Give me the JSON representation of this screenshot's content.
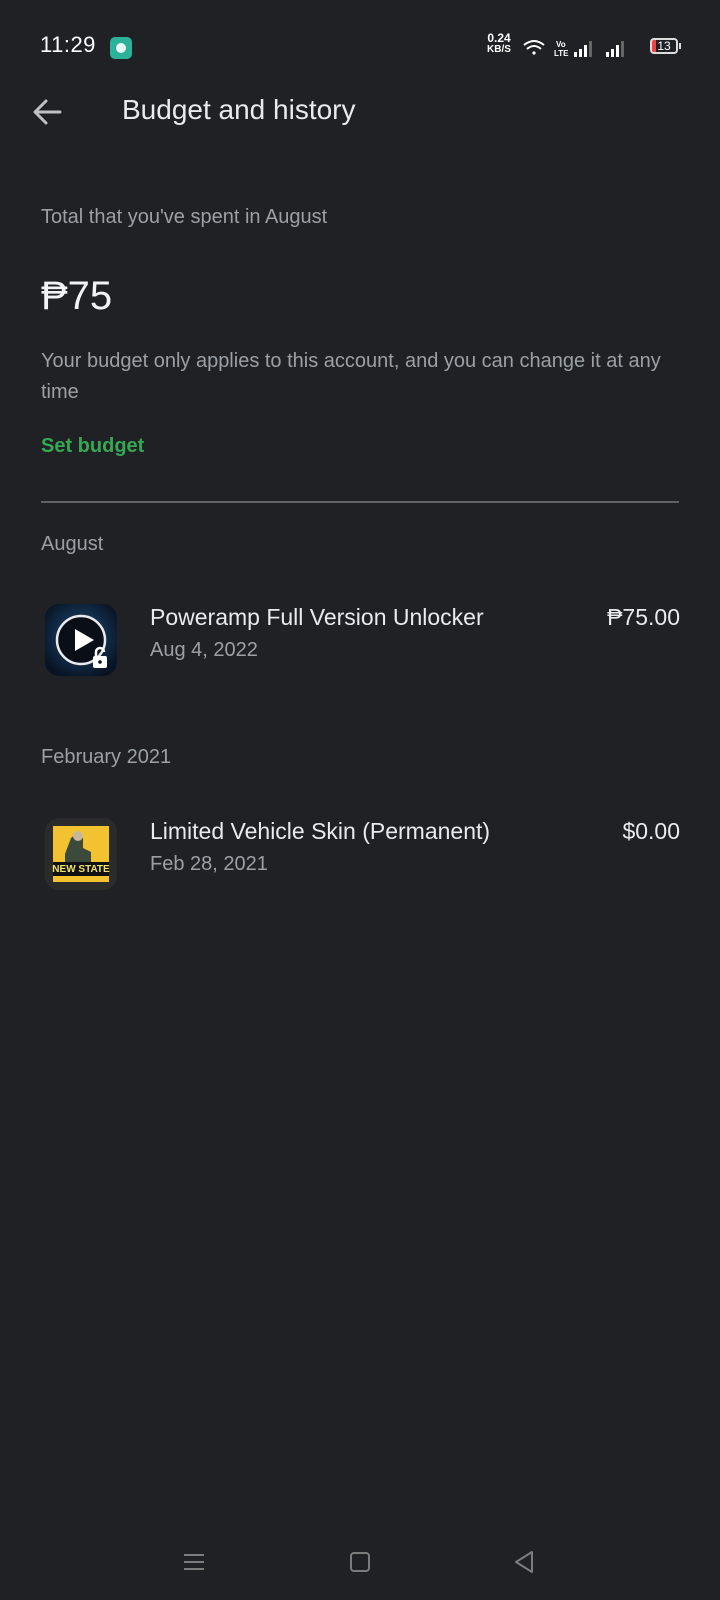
{
  "status_bar": {
    "time": "11:29",
    "net_speed_value": "0.24",
    "net_speed_unit": "KB/S",
    "volte": "Vo LTE",
    "battery": "13"
  },
  "header": {
    "title": "Budget and history",
    "back_icon": "arrow-back-icon"
  },
  "summary": {
    "label": "Total that you've spent in August",
    "amount": "₱75",
    "note": "Your budget only applies to this account, and you can change it at any time",
    "set_budget": "Set budget"
  },
  "sections": [
    {
      "label": "August",
      "items": [
        {
          "title": "Poweramp Full Version Unlocker",
          "date": "Aug 4, 2022",
          "price": "₱75.00",
          "icon": "poweramp-app-icon"
        }
      ]
    },
    {
      "label": "February 2021",
      "items": [
        {
          "title": "Limited Vehicle Skin (Permanent)",
          "date": "Feb 28, 2021",
          "price": "$0.00",
          "icon": "new-state-game-icon",
          "icon_text": "NEW STATE"
        }
      ]
    }
  ],
  "colors": {
    "background": "#202124",
    "accent": "#34a853",
    "primary_text": "#e8eaed",
    "secondary_text": "#9aa0a6"
  }
}
